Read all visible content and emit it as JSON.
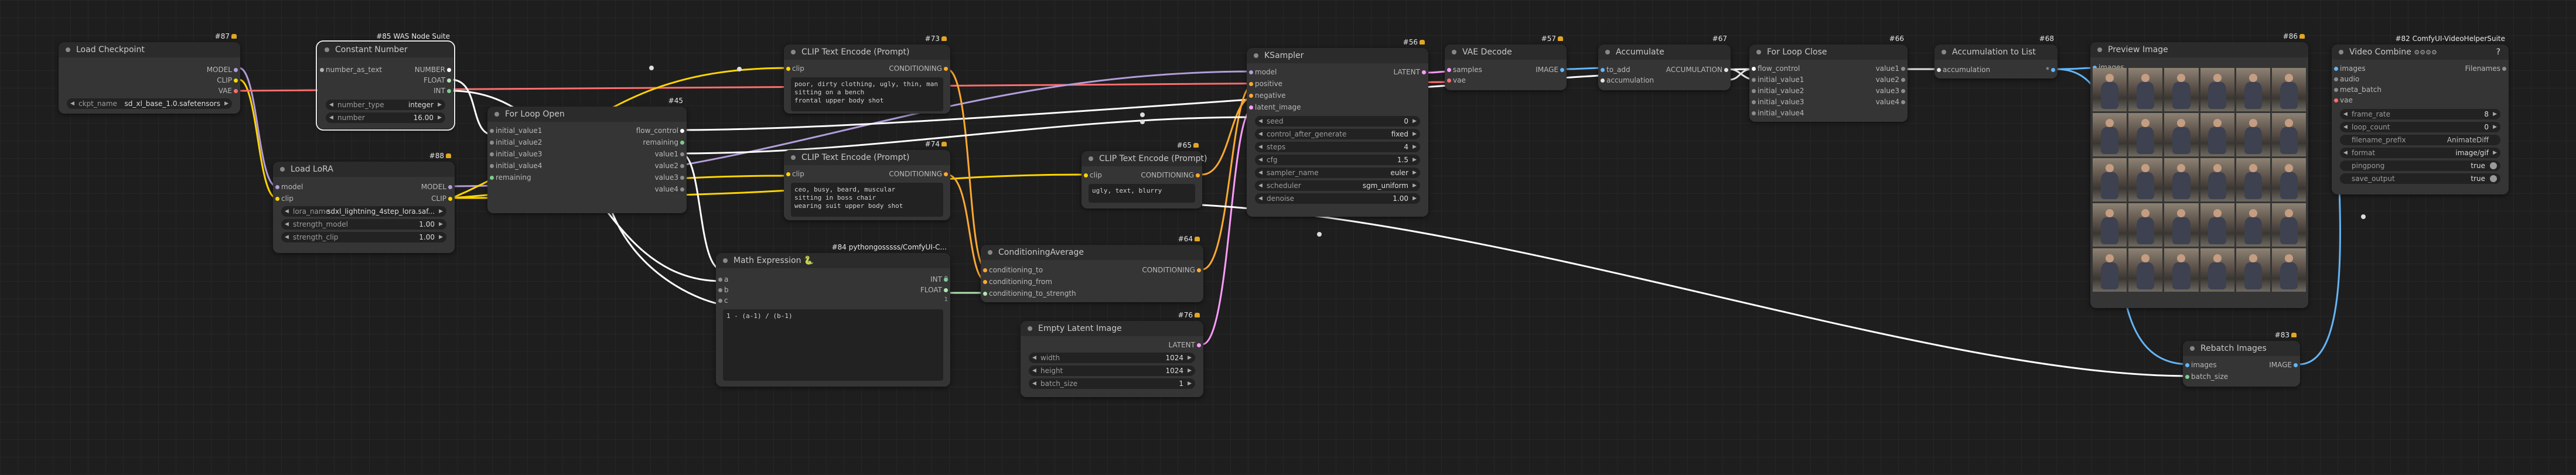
{
  "nodes": {
    "load_checkpoint": {
      "badge": "#87",
      "title": "Load Checkpoint",
      "outputs": [
        "MODEL",
        "CLIP",
        "VAE"
      ],
      "ckpt_label": "ckpt_name",
      "ckpt_value": "sd_xl_base_1.0.safetensors"
    },
    "constant_number": {
      "badge": "#85 WAS Node Suite",
      "title": "Constant Number",
      "input": "number_as_text",
      "outputs": [
        "NUMBER",
        "FLOAT",
        "INT"
      ],
      "type_label": "number_type",
      "type_value": "integer",
      "number_label": "number",
      "number_value": "16.00"
    },
    "load_lora": {
      "badge": "#88",
      "title": "Load LoRA",
      "inputs": [
        "model",
        "clip"
      ],
      "outputs": [
        "MODEL",
        "CLIP"
      ],
      "lora_label": "lora_name",
      "lora_value": "sdxl_lightning_4step_lora.saf...",
      "sm_label": "strength_model",
      "sm_value": "1.00",
      "sc_label": "strength_clip",
      "sc_value": "1.00"
    },
    "for_loop_open": {
      "badge": "#45",
      "title": "For Loop Open",
      "inputs": [
        "initial_value1",
        "initial_value2",
        "initial_value3",
        "initial_value4",
        "remaining"
      ],
      "outputs": [
        "flow_control",
        "remaining",
        "value1",
        "value2",
        "value3",
        "value4"
      ]
    },
    "clip_pos": {
      "badge": "#73",
      "title": "CLIP Text Encode (Prompt)",
      "input": "clip",
      "output": "CONDITIONING",
      "text": "poor, dirty clothing, ugly, thin, man sitting on a bench\nfrontal upper body shot"
    },
    "clip_mid": {
      "badge": "#74",
      "title": "CLIP Text Encode (Prompt)",
      "input": "clip",
      "output": "CONDITIONING",
      "text": "ceo, busy, beard, muscular\nsitting in boss chair\nwearing suit upper body shot"
    },
    "math_expression": {
      "badge": "#84 pythongosssss/ComfyUI-C...",
      "title": "Math Expression",
      "emoji": "🐍",
      "inputs": [
        "a",
        "b",
        "c"
      ],
      "outputs": [
        "INT",
        "FLOAT"
      ],
      "out_values": [
        "0",
        "1"
      ],
      "expr": "1 - (a-1) / (b-1)"
    },
    "cond_average": {
      "badge": "#64",
      "title": "ConditioningAverage",
      "inputs": [
        "conditioning_to",
        "conditioning_from",
        "conditioning_to_strength"
      ],
      "output": "CONDITIONING"
    },
    "clip_neg": {
      "badge": "#65",
      "title": "CLIP Text Encode (Prompt)",
      "input": "clip",
      "output": "CONDITIONING",
      "text": "ugly, text, blurry"
    },
    "empty_latent": {
      "badge": "#76",
      "title": "Empty Latent Image",
      "output": "LATENT",
      "width_label": "width",
      "width_value": "1024",
      "height_label": "height",
      "height_value": "1024",
      "batch_label": "batch_size",
      "batch_value": "1"
    },
    "ksampler": {
      "badge": "#56",
      "title": "KSampler",
      "inputs": [
        "model",
        "positive",
        "negative",
        "latent_image"
      ],
      "output": "LATENT",
      "widgets": [
        [
          "seed",
          "0"
        ],
        [
          "control_after_generate",
          "fixed"
        ],
        [
          "steps",
          "4"
        ],
        [
          "cfg",
          "1.5"
        ],
        [
          "sampler_name",
          "euler"
        ],
        [
          "scheduler",
          "sgm_uniform"
        ],
        [
          "denoise",
          "1.00"
        ]
      ]
    },
    "vae_decode": {
      "badge": "#57",
      "title": "VAE Decode",
      "inputs": [
        "samples",
        "vae"
      ],
      "output": "IMAGE"
    },
    "accumulate": {
      "badge": "#67",
      "title": "Accumulate",
      "inputs": [
        "to_add",
        "accumulation"
      ],
      "output": "ACCUMULATION"
    },
    "for_loop_close": {
      "badge": "#66",
      "title": "For Loop Close",
      "inputs": [
        "flow_control",
        "initial_value1",
        "initial_value2",
        "initial_value3",
        "initial_value4"
      ],
      "outputs": [
        "value1",
        "value2",
        "value3",
        "value4"
      ]
    },
    "acc_to_list": {
      "badge": "#68",
      "title": "Accumulation to List",
      "input": "accumulation",
      "output": "*"
    },
    "preview_image": {
      "badge": "#86",
      "title": "Preview Image",
      "input": "images"
    },
    "rebatch": {
      "badge": "#83",
      "title": "Rebatch Images",
      "inputs": [
        "images",
        "batch_size"
      ],
      "output": "IMAGE"
    },
    "video_combine": {
      "badge": "#82 ComfyUI-VideoHelperSuite",
      "title": "Video Combine",
      "title_icons": "⚙⚙⚙⚙",
      "help": "?",
      "inputs": [
        "images",
        "audio",
        "meta_batch",
        "vae"
      ],
      "output": "Filenames",
      "widgets": [
        [
          "frame_rate",
          "8"
        ],
        [
          "loop_count",
          "0"
        ],
        [
          "filename_prefix",
          "AnimateDiff"
        ],
        [
          "format",
          "image/gif"
        ]
      ],
      "toggles": [
        [
          "pingpong",
          "true"
        ],
        [
          "save_output",
          "true"
        ]
      ]
    }
  },
  "colors": {
    "model": "#b39ddb",
    "clip": "#ffd500",
    "vae": "#ff6e6e",
    "conditioning": "#ffa931",
    "latent": "#ff9cf9",
    "image": "#64b5f6",
    "int": "#7ccc8a",
    "number": "#ffffff",
    "float": "#b0e5b0",
    "wildcard": "#b0b0b0",
    "accumulation": "#e0e0e0"
  }
}
